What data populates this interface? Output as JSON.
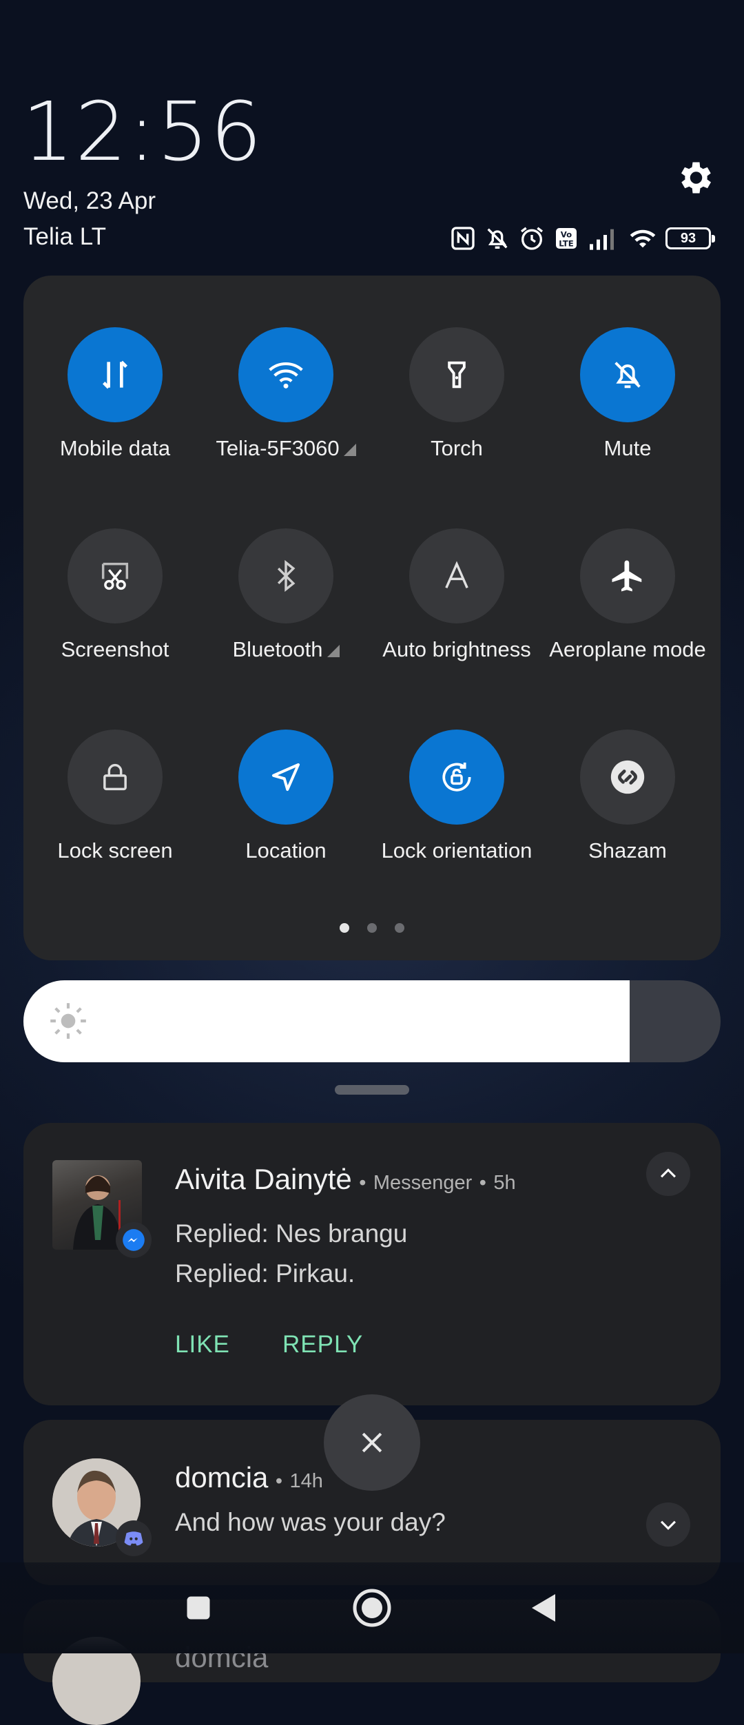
{
  "header": {
    "time": "12:56",
    "date": "Wed, 23 Apr",
    "carrier": "Telia LT",
    "battery_level": "93",
    "status_icons": [
      "nfc-icon",
      "bell-off-icon",
      "alarm-icon",
      "volte-icon",
      "signal-icon",
      "wifi-icon",
      "battery-icon"
    ]
  },
  "quick_settings": {
    "tiles": [
      {
        "label": "Mobile data",
        "icon": "mobile-data-icon",
        "active": true
      },
      {
        "label": "Telia-5F3060",
        "icon": "wifi-icon",
        "active": true,
        "expandable": true
      },
      {
        "label": "Torch",
        "icon": "torch-icon",
        "active": false
      },
      {
        "label": "Mute",
        "icon": "bell-off-icon",
        "active": true
      },
      {
        "label": "Screenshot",
        "icon": "screenshot-icon",
        "active": false
      },
      {
        "label": "Bluetooth",
        "icon": "bluetooth-icon",
        "active": false,
        "expandable": true
      },
      {
        "label": "Auto brightness",
        "icon": "auto-brightness-icon",
        "active": false
      },
      {
        "label": "Aeroplane mode",
        "icon": "airplane-icon",
        "active": false
      },
      {
        "label": "Lock screen",
        "icon": "lock-icon",
        "active": false
      },
      {
        "label": "Location",
        "icon": "location-icon",
        "active": true
      },
      {
        "label": "Lock orientation",
        "icon": "rotation-lock-icon",
        "active": true
      },
      {
        "label": "Shazam",
        "icon": "shazam-icon",
        "active": false
      }
    ],
    "page_count": 3,
    "current_page": 1
  },
  "brightness": {
    "level_percent": 87,
    "icon": "sun-icon"
  },
  "notifications": [
    {
      "title": "Aivita Dainytė",
      "app": "Messenger",
      "time": "5h",
      "lines": [
        "Replied: Nes brangu",
        "Replied: Pirkau."
      ],
      "actions": [
        "LIKE",
        "REPLY"
      ],
      "expanded": true,
      "badge_icon": "messenger-icon"
    },
    {
      "title": "domcia",
      "time": "14h",
      "lines": [
        "And how was your day?"
      ],
      "expanded": false,
      "badge_icon": "discord-icon"
    },
    {
      "title": "domcia"
    }
  ],
  "separator": "•",
  "colors": {
    "accent": "#0a76d2",
    "action": "#7fe3b4",
    "panel": "#262729",
    "card": "#202124"
  }
}
